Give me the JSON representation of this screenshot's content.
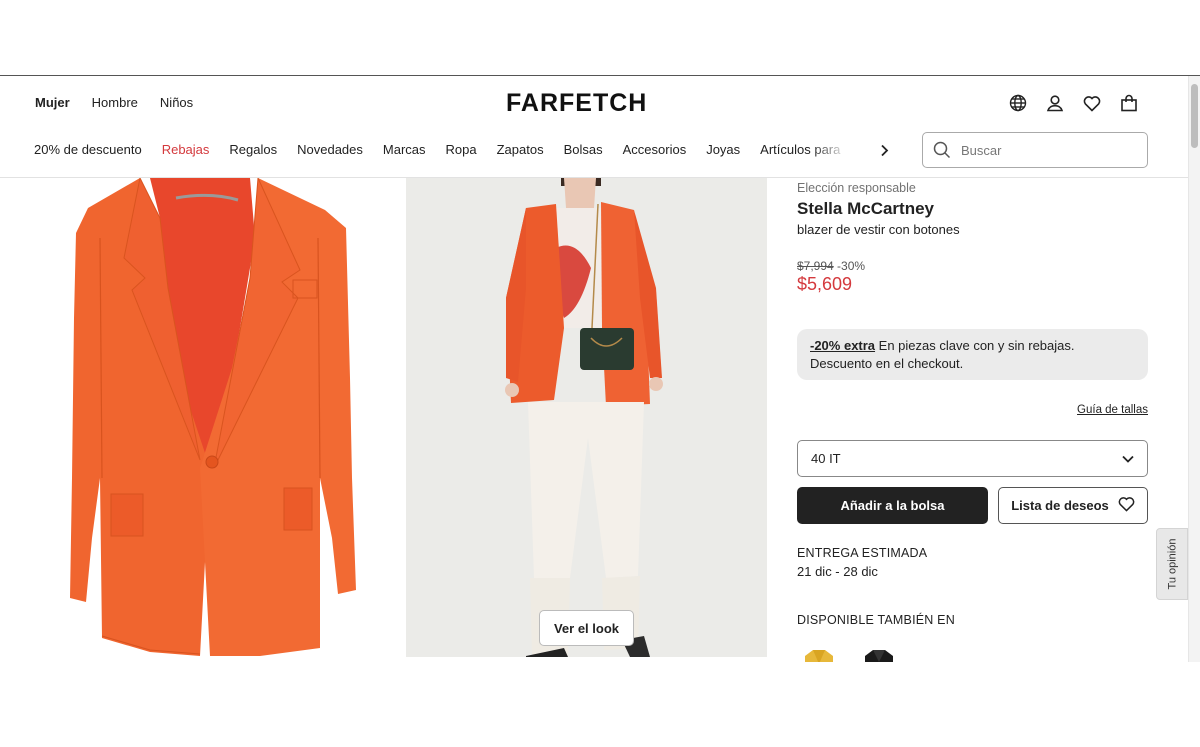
{
  "header": {
    "gender_tabs": [
      "Mujer",
      "Hombre",
      "Niños"
    ],
    "logo": "FARFETCH",
    "icons": [
      "globe-icon",
      "account-icon",
      "heart-icon",
      "bag-icon"
    ]
  },
  "categories": [
    "20% de descuento",
    "Rebajas",
    "Regalos",
    "Novedades",
    "Marcas",
    "Ropa",
    "Zapatos",
    "Bolsas",
    "Accesorios",
    "Joyas",
    "Artículos para"
  ],
  "search": {
    "placeholder": "Buscar"
  },
  "gallery": {
    "look_button": "Ver el look"
  },
  "product": {
    "responsible_label": "Elección responsable",
    "brand": "Stella McCartney",
    "name": "blazer de vestir con botones",
    "original_price": "$7,994",
    "discount": "-30%",
    "price": "$5,609",
    "promo_highlight": "-20% extra",
    "promo_text": " En piezas clave con y sin rebajas. Descuento en el checkout.",
    "size_guide": "Guía de tallas",
    "selected_size": "40 IT",
    "add_to_bag": "Añadir a la bolsa",
    "wishlist": "Lista de deseos",
    "delivery_title": "ENTREGA ESTIMADA",
    "delivery_dates": "21 dic - 28 dic",
    "also_available_title": "DISPONIBLE TAMBIÉN EN"
  },
  "feedback_tab": "Tu opinión",
  "colors": {
    "sale_red": "#d4393d",
    "blazer_orange": "#f0652f",
    "primary_button": "#222222"
  }
}
